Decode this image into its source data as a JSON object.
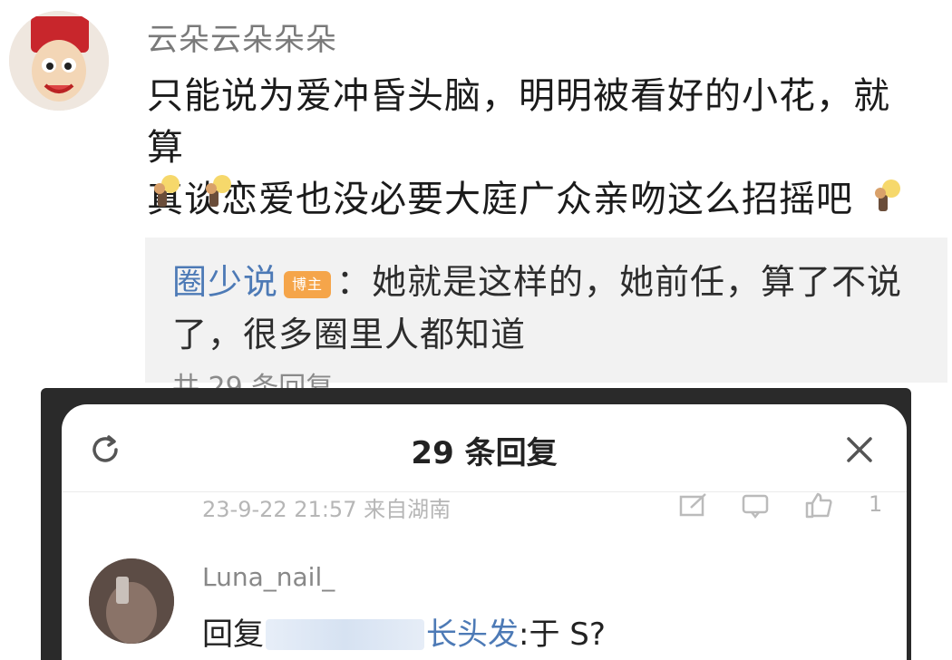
{
  "post": {
    "username": "云朵云朵朵朵",
    "comment_line1": "只能说为爱冲昏头脑，明明被看好的小花，就算",
    "comment_line2": "真谈恋爱也没必要大庭广众亲吻这么招摇吧",
    "emoji_name": "lightbulb-person-emoji"
  },
  "reply": {
    "author": "圈少说",
    "badge": "博主",
    "text": "：她就是这样的，她前任，算了不说了，很多圈里人都知道",
    "count_text": "共 29 条回复"
  },
  "sheet": {
    "title": "29 条回复",
    "meta": "23-9-22 21:57 来自湖南",
    "like_count": "1",
    "reply_user": "Luna_nail_",
    "reply_prefix": "回复",
    "reply_mention": "长头发",
    "reply_suffix": ":于 S?"
  },
  "colors": {
    "link": "#4d7ab6",
    "muted": "#7a7a7a",
    "badge": "#f5a54a"
  }
}
